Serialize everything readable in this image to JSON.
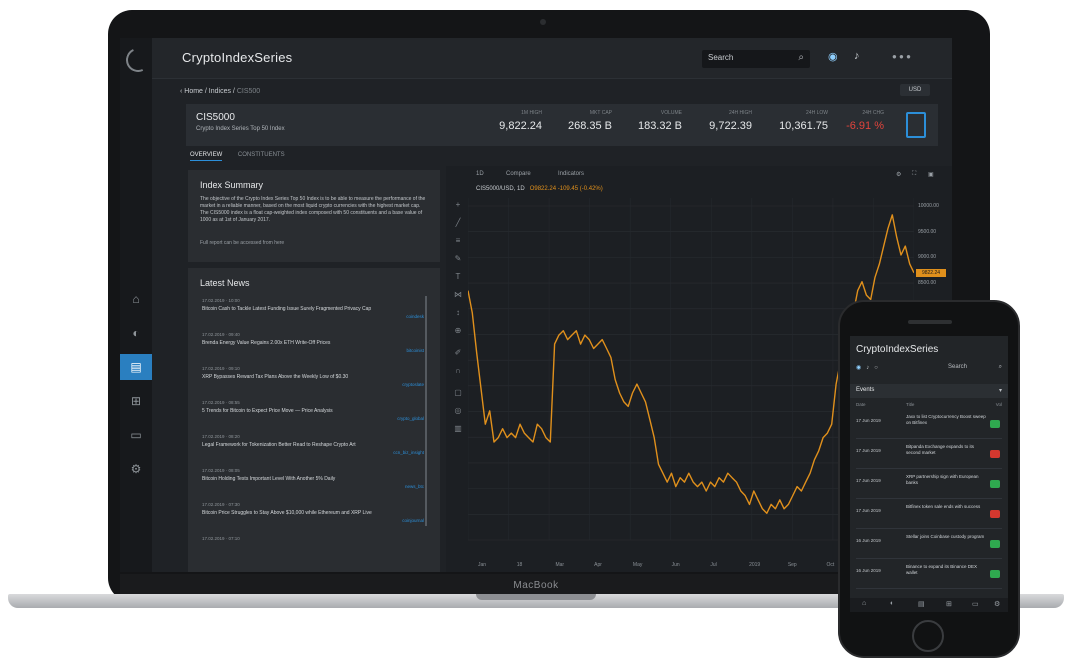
{
  "laptop": {
    "brand": "MacBook",
    "app_title": "CryptoIndexSeries",
    "search_placeholder": "Search",
    "user": "● ● ●",
    "breadcrumb": {
      "path": "Home / Indices /",
      "current": "CIS500"
    },
    "mini_button": "USD",
    "index": {
      "symbol": "CIS5000",
      "name": "Crypto Index Series Top 50 Index",
      "stats": [
        {
          "label": "1M HIGH",
          "value": "9,822.24"
        },
        {
          "label": "MKT CAP",
          "value": "268.35 B"
        },
        {
          "label": "VOLUME",
          "value": "183.32 B"
        },
        {
          "label": "24H HIGH",
          "value": "9,722.39"
        },
        {
          "label": "24H LOW",
          "value": "10,361.75"
        },
        {
          "label": "24H CHG",
          "value": "-6.91 %",
          "negative": true
        }
      ]
    },
    "tabs": [
      "OVERVIEW",
      "CONSTITUENTS"
    ],
    "summary": {
      "title": "Index Summary",
      "text": "The objective of the Crypto Index Series Top 50 Index is to be able to measure the performance of the market in a reliable manner, based on the most liquid crypto currencies with the highest market cap. The CIS5000 index is a float cap-weighted index composed with 50 constituents and a base value of 1000 as at 1st of January 2017.",
      "link": "Full report can be accessed from here"
    },
    "news": {
      "title": "Latest News",
      "items": [
        {
          "date": "17.02.2019 · 10:00",
          "headline": "Bitcoin Cash to Tackle Latest Funding Issue Surely Fragmented Privacy Cap",
          "source": "coindesk"
        },
        {
          "date": "17.02.2019 · 09:40",
          "headline": "Brenda Energy Value Regains 2.00x ETH Write-Off Prices",
          "source": "bitcoinist"
        },
        {
          "date": "17.02.2019 · 09:10",
          "headline": "XRP Bypasses Reward Tax Plans Above the Weekly Low of $0.30",
          "source": "cryptoslate"
        },
        {
          "date": "17.02.2019 · 08:55",
          "headline": "5 Trends for Bitcoin to Expect Price Move — Price Analysis",
          "source": "crypto_global"
        },
        {
          "date": "17.02.2019 · 08:20",
          "headline": "Legal Framework for Tokenization Better Read to Reshape Crypto Art",
          "source": "ccn_biz_insight"
        },
        {
          "date": "17.02.2019 · 08:05",
          "headline": "Bitcoin Holding Tests Important Level With Another 5% Daily",
          "source": "news_btc"
        },
        {
          "date": "17.02.2019 · 07:30",
          "headline": "Bitcoin Price Struggles to Stay Above $10,000 while Ethereum and XRP Live",
          "source": "coinjournal"
        },
        {
          "date": "17.02.2019 · 07:10",
          "headline": "",
          "source": ""
        }
      ]
    },
    "chart": {
      "toolbar": [
        "1D",
        "Compare",
        "Indicators"
      ],
      "legend_symbol": "CIS5000/USD, 1D",
      "legend_values": "O9822.24   -109.45  (-0.42%)"
    }
  },
  "chart_data": {
    "type": "line",
    "title": "",
    "xlabel": "",
    "ylabel": "",
    "color": "#e0901c",
    "ylim": [
      3000,
      10500
    ],
    "yticks": [
      "10000.00",
      "9500.00",
      "9000.00",
      "8500.00",
      "8000.00",
      "7500.00",
      "7000.00",
      "6500.00",
      "6000.00",
      "5500.00",
      "5000.00",
      "4500.00",
      "4000.00",
      "3500.00"
    ],
    "last_value": "9822.24",
    "xticks": [
      "Jan",
      "18",
      "Mar",
      "Apr",
      "May",
      "Jun",
      "Jul",
      "2019",
      "Sep",
      "Oct",
      "Nov",
      "Dec"
    ],
    "values": [
      8600,
      8100,
      7200,
      6400,
      5600,
      5900,
      5200,
      5300,
      5500,
      5300,
      5400,
      5300,
      5600,
      5400,
      5300,
      5200,
      5600,
      5500,
      5300,
      5200,
      7400,
      7600,
      7700,
      7500,
      7600,
      7700,
      7400,
      7600,
      7500,
      7300,
      7400,
      7500,
      7300,
      7100,
      6600,
      6300,
      6100,
      6000,
      6300,
      6500,
      6300,
      6100,
      5700,
      5300,
      4700,
      4500,
      4300,
      4500,
      4200,
      4400,
      4300,
      4500,
      4300,
      4200,
      4300,
      4100,
      4300,
      4200,
      4400,
      4300,
      4500,
      4400,
      4300,
      4100,
      4000,
      3800,
      4100,
      3900,
      3700,
      3600,
      3800,
      3700,
      3900,
      3700,
      3800,
      4000,
      4200,
      4100,
      4300,
      4500,
      4800,
      5000,
      5300,
      5400,
      5600,
      6500,
      7000,
      7500,
      7600,
      8100,
      8600,
      8800,
      8500,
      8400,
      8900,
      9200,
      9600,
      10000,
      10300,
      9800,
      9400,
      9600,
      9200,
      9000
    ]
  },
  "phone": {
    "title": "CryptoIndexSeries",
    "search": "Search",
    "section": "Events",
    "header": [
      "Date",
      "Title",
      "Vol"
    ],
    "items": [
      {
        "date": "17 Jun 2019",
        "text": "Jaxx to list Cryptocurrency Boost sweep on Bitfinex",
        "positive": true
      },
      {
        "date": "17 Jun 2019",
        "text": "Bitpanda Exchange expands to its second market",
        "positive": false
      },
      {
        "date": "17 Jun 2019",
        "text": "XRP partnership sign with European banks",
        "positive": true
      },
      {
        "date": "17 Jun 2019",
        "text": "Bitfinex token sale ends with success",
        "positive": false
      },
      {
        "date": "16 Jun 2019",
        "text": "Stellar joins Coinbase custody program",
        "positive": true
      },
      {
        "date": "16 Jun 2019",
        "text": "Binance to expand its Binance DEX wallet",
        "positive": true
      }
    ]
  }
}
